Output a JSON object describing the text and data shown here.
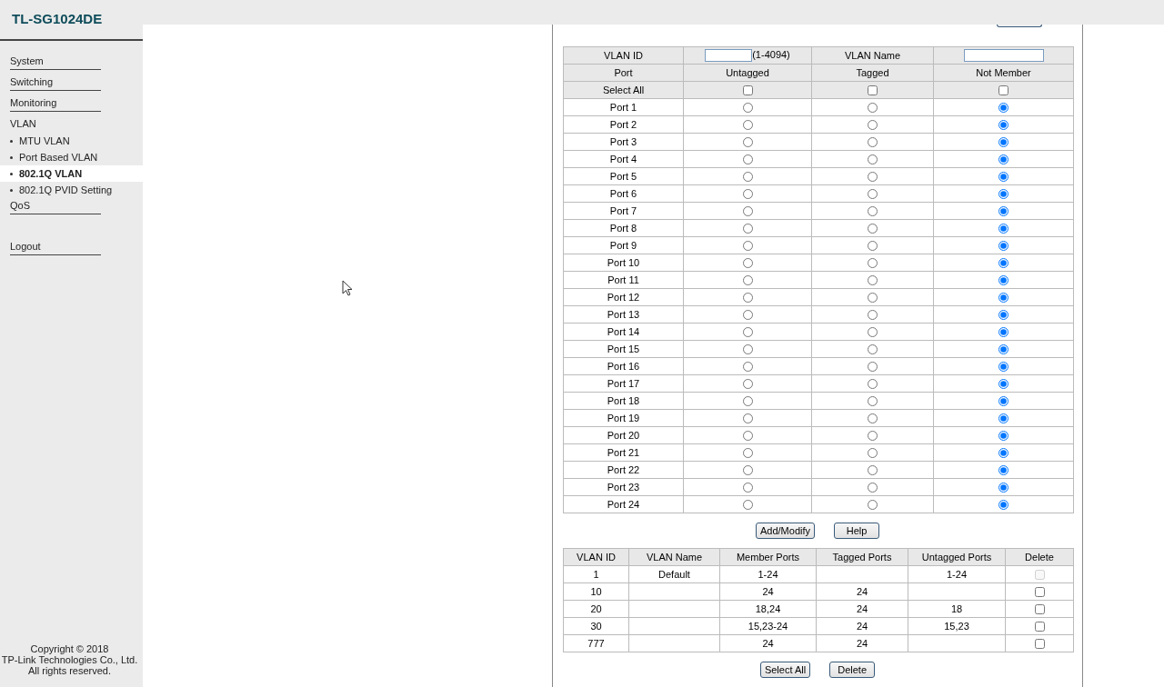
{
  "title": "TL-SG1024DE",
  "sidebar": {
    "items": [
      {
        "label": "System",
        "kind": "menu",
        "selected": false
      },
      {
        "label": "Switching",
        "kind": "menu",
        "selected": false
      },
      {
        "label": "Monitoring",
        "kind": "menu",
        "selected": false
      },
      {
        "label": "VLAN",
        "kind": "group",
        "selected": false
      },
      {
        "label": "MTU VLAN",
        "kind": "sub",
        "selected": false
      },
      {
        "label": "Port Based VLAN",
        "kind": "sub",
        "selected": false
      },
      {
        "label": "802.1Q VLAN",
        "kind": "sub",
        "selected": true
      },
      {
        "label": "802.1Q PVID Setting",
        "kind": "sub",
        "selected": false
      },
      {
        "label": "QoS",
        "kind": "menu",
        "selected": false
      },
      {
        "label": "Logout",
        "kind": "logout",
        "selected": false
      }
    ],
    "copyright": [
      "Copyright © 2018",
      "TP-Link Technologies Co., Ltd. All rights reserved."
    ]
  },
  "vlan_form": {
    "vlan_id_label": "VLAN ID",
    "vlan_id_range": "(1-4094)",
    "vlan_name_label": "VLAN Name",
    "columns": [
      "Port",
      "Untagged",
      "Tagged",
      "Not Member"
    ],
    "select_all": {
      "label": "Select All",
      "untagged_checked": false,
      "tagged_checked": false,
      "not_member_checked": false
    },
    "ports": [
      {
        "label": "Port 1",
        "untagged": false,
        "tagged": false,
        "not_member": true
      },
      {
        "label": "Port 2",
        "untagged": false,
        "tagged": false,
        "not_member": true
      },
      {
        "label": "Port 3",
        "untagged": false,
        "tagged": false,
        "not_member": true
      },
      {
        "label": "Port 4",
        "untagged": false,
        "tagged": false,
        "not_member": true
      },
      {
        "label": "Port 5",
        "untagged": false,
        "tagged": false,
        "not_member": true
      },
      {
        "label": "Port 6",
        "untagged": false,
        "tagged": false,
        "not_member": true
      },
      {
        "label": "Port 7",
        "untagged": false,
        "tagged": false,
        "not_member": true
      },
      {
        "label": "Port 8",
        "untagged": false,
        "tagged": false,
        "not_member": true
      },
      {
        "label": "Port 9",
        "untagged": false,
        "tagged": false,
        "not_member": true
      },
      {
        "label": "Port 10",
        "untagged": false,
        "tagged": false,
        "not_member": true
      },
      {
        "label": "Port 11",
        "untagged": false,
        "tagged": false,
        "not_member": true
      },
      {
        "label": "Port 12",
        "untagged": false,
        "tagged": false,
        "not_member": true
      },
      {
        "label": "Port 13",
        "untagged": false,
        "tagged": false,
        "not_member": true
      },
      {
        "label": "Port 14",
        "untagged": false,
        "tagged": false,
        "not_member": true
      },
      {
        "label": "Port 15",
        "untagged": false,
        "tagged": false,
        "not_member": true
      },
      {
        "label": "Port 16",
        "untagged": false,
        "tagged": false,
        "not_member": true
      },
      {
        "label": "Port 17",
        "untagged": false,
        "tagged": false,
        "not_member": true
      },
      {
        "label": "Port 18",
        "untagged": false,
        "tagged": false,
        "not_member": true
      },
      {
        "label": "Port 19",
        "untagged": false,
        "tagged": false,
        "not_member": true
      },
      {
        "label": "Port 20",
        "untagged": false,
        "tagged": false,
        "not_member": true
      },
      {
        "label": "Port 21",
        "untagged": false,
        "tagged": false,
        "not_member": true
      },
      {
        "label": "Port 22",
        "untagged": false,
        "tagged": false,
        "not_member": true
      },
      {
        "label": "Port 23",
        "untagged": false,
        "tagged": false,
        "not_member": true
      },
      {
        "label": "Port 24",
        "untagged": false,
        "tagged": false,
        "not_member": true
      }
    ],
    "buttons": [
      "Add/Modify",
      "Help"
    ]
  },
  "vlan_table": {
    "columns": [
      "VLAN ID",
      "VLAN Name",
      "Member Ports",
      "Tagged Ports",
      "Untagged Ports",
      "Delete"
    ],
    "rows": [
      {
        "cells": [
          "1",
          "Default",
          "1-24",
          "",
          "1-24"
        ],
        "checked": false,
        "disabled": true
      },
      {
        "cells": [
          "10",
          "",
          "24",
          "24",
          ""
        ],
        "checked": false,
        "disabled": false
      },
      {
        "cells": [
          "20",
          "",
          "18,24",
          "24",
          "18"
        ],
        "checked": false,
        "disabled": false
      },
      {
        "cells": [
          "30",
          "",
          "15,23-24",
          "24",
          "15,23"
        ],
        "checked": false,
        "disabled": false
      },
      {
        "cells": [
          "777",
          "",
          "24",
          "24",
          ""
        ],
        "checked": false,
        "disabled": false
      }
    ],
    "buttons": [
      "Select All",
      "Delete"
    ]
  }
}
